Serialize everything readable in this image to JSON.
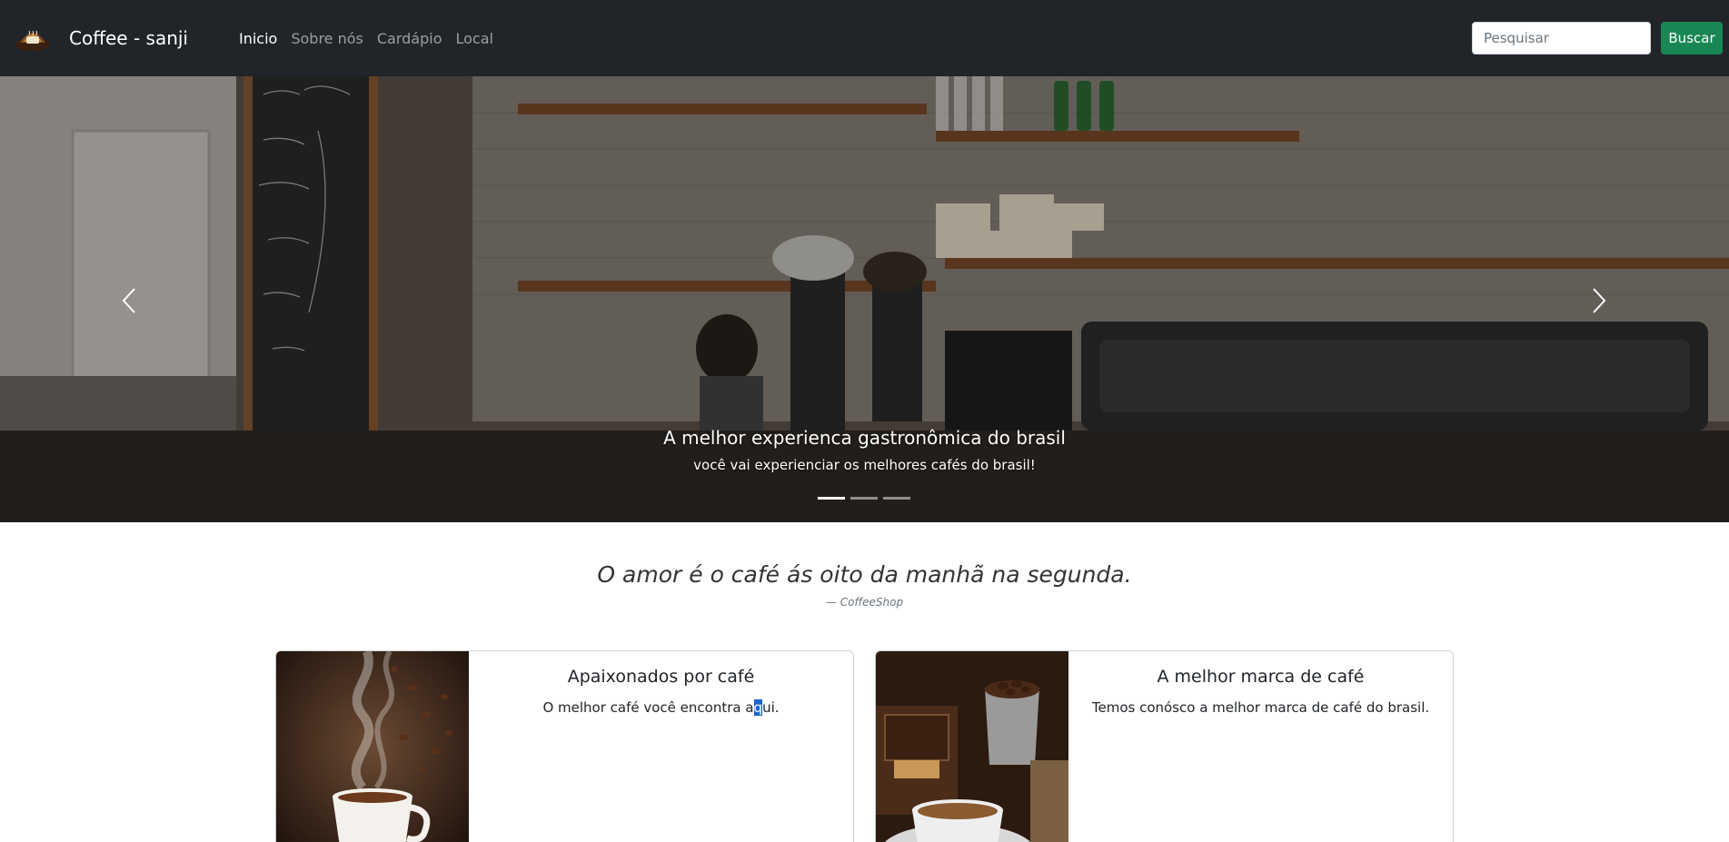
{
  "brand": {
    "name": "Coffee - sanji",
    "logo_icon": "coffee-logo-icon"
  },
  "nav": {
    "links": [
      {
        "label": "Inicio",
        "active": true
      },
      {
        "label": "Sobre nós",
        "active": false
      },
      {
        "label": "Cardápio",
        "active": false
      },
      {
        "label": "Local",
        "active": false
      }
    ]
  },
  "search": {
    "placeholder": "Pesquisar",
    "button_label": "Buscar"
  },
  "carousel": {
    "caption_title": "A melhor experienca gastronômica do brasil",
    "caption_text": "você vai experienciar os melhores cafés do brasil!",
    "slide_count": 3,
    "active_index": 0,
    "prev_icon": "chevron-left-icon",
    "next_icon": "chevron-right-icon"
  },
  "quote": {
    "text": "O amor é o café ás oito da manhã na segunda.",
    "author": "— CoffeeShop"
  },
  "cards": [
    {
      "title": "Apaixonados por café",
      "text_before": "O melhor café você encontra a",
      "text_selected": "q",
      "text_after": "ui.",
      "image": "steaming-coffee-cup-image"
    },
    {
      "title": "A melhor marca de café",
      "text": "Temos conósco a melhor marca de café do brasil.",
      "image": "coffee-grinder-cup-image"
    }
  ],
  "colors": {
    "navbar_bg": "#212529",
    "search_button": "#198754",
    "selection": "#1a64c8"
  }
}
